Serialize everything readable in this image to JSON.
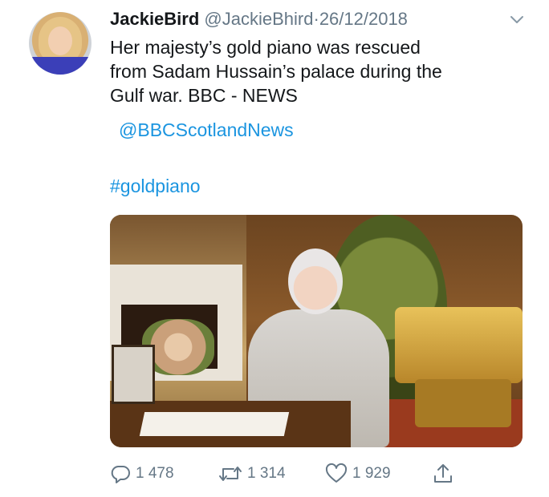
{
  "tweet": {
    "display_name": "JackieBird",
    "handle": "@JackieBhird",
    "separator": "·",
    "date": "26/12/2018",
    "text_lines": [
      "Her majesty’s gold piano was rescued",
      "from Sadam Hussain’s palace during the",
      "Gulf war. BBC - NEWS"
    ],
    "mention": "@BBCScotlandNews",
    "hashtag": "#goldpiano"
  },
  "actions": {
    "replies": "1 478",
    "retweets": "1 314",
    "likes": "1 929"
  },
  "icons": {
    "menu": "chevron-down-icon",
    "reply": "reply-icon",
    "retweet": "retweet-icon",
    "like": "heart-icon",
    "share": "share-icon"
  },
  "colors": {
    "link": "#1b95e0",
    "muted": "#657786",
    "text": "#14171a"
  }
}
